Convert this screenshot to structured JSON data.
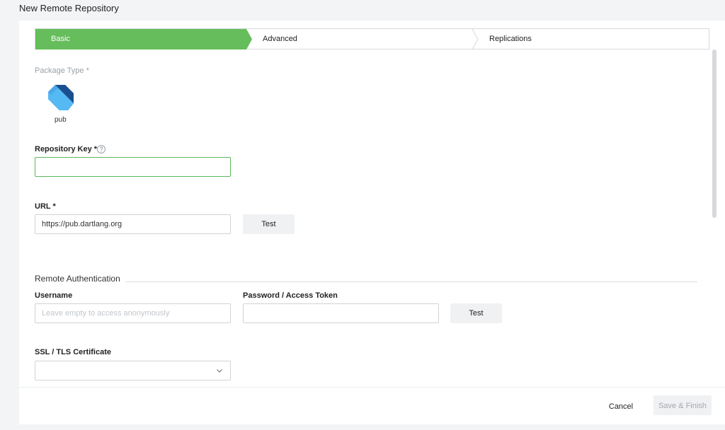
{
  "page": {
    "title": "New Remote Repository"
  },
  "wizard": {
    "steps": [
      {
        "label": "Basic",
        "active": true
      },
      {
        "label": "Advanced",
        "active": false
      },
      {
        "label": "Replications",
        "active": false
      }
    ],
    "active_color": "#65bd5b"
  },
  "package_type": {
    "label": "Package Type *",
    "selected": "pub",
    "icon": "dart-logo-icon"
  },
  "repository_key": {
    "label": "Repository Key *",
    "value": "",
    "help_icon": "question-circle-icon"
  },
  "url": {
    "label": "URL *",
    "value": "https://pub.dartlang.org",
    "test_label": "Test"
  },
  "remote_auth": {
    "title": "Remote Authentication",
    "username_label": "Username",
    "username_placeholder": "Leave empty to access anonymously",
    "password_label": "Password / Access Token",
    "test_label": "Test"
  },
  "ssl": {
    "label": "SSL / TLS Certificate",
    "value": "",
    "icon": "chevron-down-icon"
  },
  "footer": {
    "cancel_label": "Cancel",
    "save_label": "Save & Finish"
  }
}
